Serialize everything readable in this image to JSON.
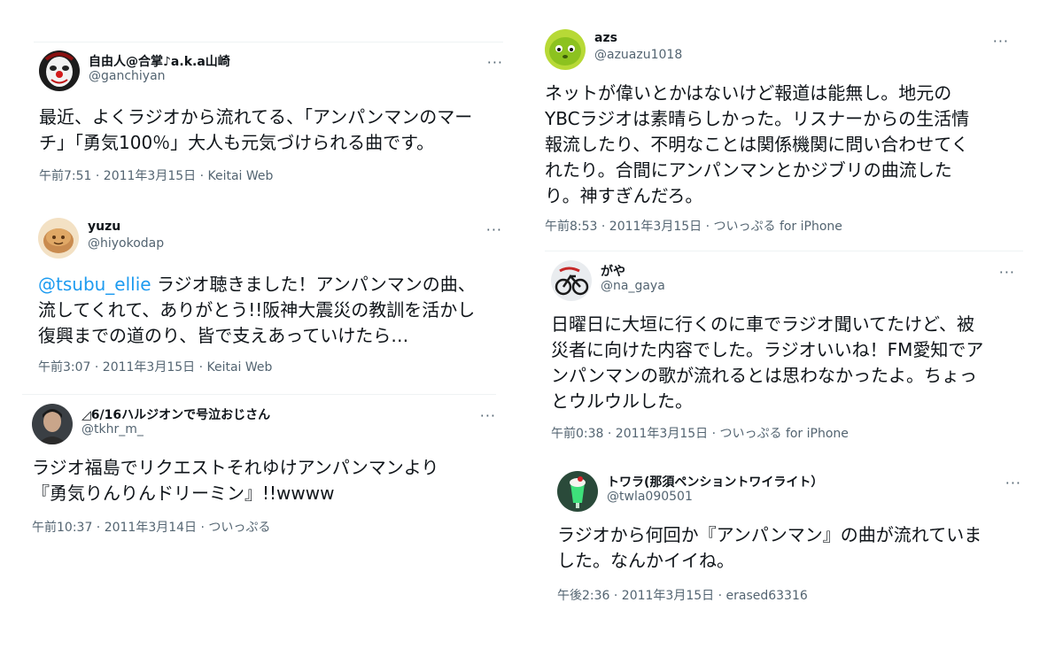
{
  "tweets": [
    {
      "name": "自由人@合掌♪a.k.a山崎",
      "handle": "@ganchiyan",
      "more": "···",
      "lines": [
        "最近、よくラジオから流れてる、「アンパンマンのマー",
        "チ」「勇気100％」大人も元気づけられる曲です。"
      ],
      "meta": "午前7:51 · 2011年3月15日 · Keitai Web"
    },
    {
      "name": "yuzu",
      "handle": "@hiyokodap",
      "more": "···",
      "mention": "@tsubu_ellie",
      "lines": [
        " ラジオ聴きました！アンパンマンの曲、",
        "流してくれて、ありがとう!!阪神大震災の教訓を活かし",
        "復興までの道のり、皆で支えあっていけたら…"
      ],
      "meta": "午前3:07 · 2011年3月15日 · Keitai Web"
    },
    {
      "name": "◿6/16ハルジオンで号泣おじさん",
      "handle": "@tkhr_m_",
      "more": "···",
      "lines": [
        "ラジオ福島でリクエストそれゆけアンパンマンより",
        "『勇気りんりんドリーミン』!!wwww"
      ],
      "meta": "午前10:37 · 2011年3月14日 · ついっぷる"
    },
    {
      "name": "azs",
      "handle": "@azuazu1018",
      "more": "···",
      "lines": [
        "ネットが偉いとかはないけど報道は能無し。地元の",
        "YBCラジオは素晴らしかった。リスナーからの生活情",
        "報流したり、不明なことは関係機関に問い合わせてく",
        "れたり。合間にアンパンマンとかジブリの曲流した",
        "り。神すぎんだろ。"
      ],
      "meta": "午前8:53 · 2011年3月15日 · ついっぷる for iPhone"
    },
    {
      "name": "がや",
      "handle": "@na_gaya",
      "more": "···",
      "lines": [
        "日曜日に大垣に行くのに車でラジオ聞いてたけど、被",
        "災者に向けた内容でした。ラジオいいね！FM愛知でア",
        "ンパンマンの歌が流れるとは思わなかったよ。ちょっ",
        "とウルウルした。"
      ],
      "meta": "午前0:38 · 2011年3月15日 · ついっぷる for iPhone"
    },
    {
      "name": "トワラ(那須ペンショントワイライト）",
      "handle": "@twla090501",
      "more": "···",
      "lines": [
        "ラジオから何回か『アンパンマン』の曲が流れていま",
        "した。なんかイイね。"
      ],
      "meta": "午後2:36 · 2011年3月15日 · erased63316"
    }
  ],
  "colors": {
    "text": "#0f1419",
    "secondary": "#536471",
    "link": "#1d9bf0",
    "divider": "#eff3f4"
  },
  "icons": [
    "clown-avatar-icon",
    "bread-avatar-icon",
    "person-avatar-icon",
    "green-creature-avatar-icon",
    "bicycle-art-avatar-icon",
    "melon-soda-avatar-icon",
    "more-options-icon"
  ]
}
